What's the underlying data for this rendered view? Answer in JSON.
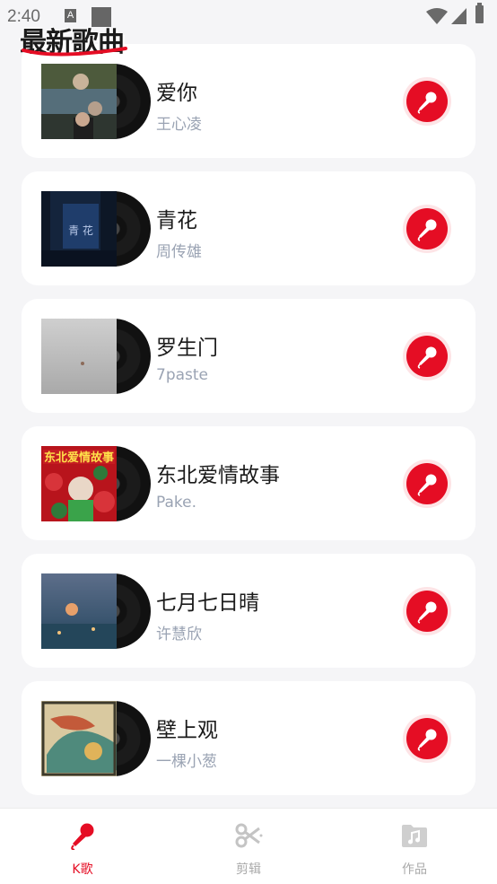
{
  "status_bar": {
    "time": "2:40",
    "notif_letter": "A"
  },
  "header": {
    "title": "最新歌曲"
  },
  "songs": [
    {
      "name": "爱你",
      "artist": "王心凌",
      "cover": "photo-people"
    },
    {
      "name": "青花",
      "artist": "周传雄",
      "cover": "night-blue"
    },
    {
      "name": "罗生门",
      "artist": "7paste",
      "cover": "grey-fog"
    },
    {
      "name": "东北爱情故事",
      "artist": "Pake.",
      "cover": "red-floral",
      "cover_text": "东北爱情故事"
    },
    {
      "name": "七月七日晴",
      "artist": "许慧欣",
      "cover": "twilight"
    },
    {
      "name": "壁上观",
      "artist": "一棵小葱",
      "cover": "painting"
    }
  ],
  "bottom_nav": [
    {
      "label": "K歌",
      "icon": "microphone-icon",
      "active": true
    },
    {
      "label": "剪辑",
      "icon": "scissors-icon",
      "active": false
    },
    {
      "label": "作品",
      "icon": "music-folder-icon",
      "active": false
    }
  ],
  "colors": {
    "accent": "#e50d24",
    "artist_text": "#9aa3b3",
    "background": "#f5f5f7"
  }
}
